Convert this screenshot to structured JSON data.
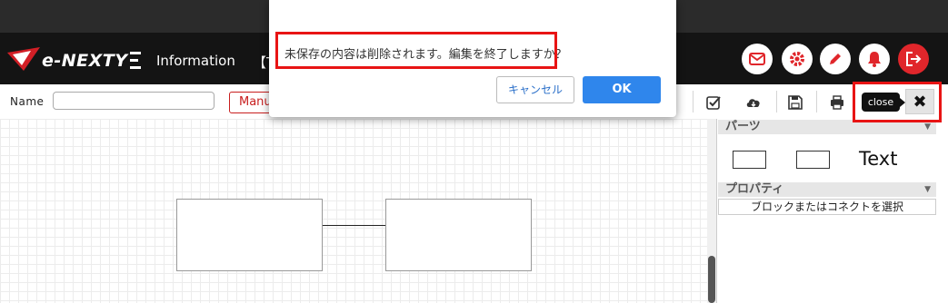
{
  "header": {
    "logo_text": "e-NEXTY",
    "nav": [
      "Information",
      "【T"
    ],
    "icons": [
      "mail-icon",
      "gear-icon",
      "pencil-icon",
      "bell-icon",
      "logout-icon"
    ],
    "accent_color": "#e0262b"
  },
  "toolbar": {
    "name_label": "Name",
    "name_value": "",
    "manual_label": "Manu",
    "icons": [
      "check-icon",
      "cloud-download-icon",
      "save-icon",
      "print-icon"
    ],
    "tooltip": "close",
    "close_label": "✖"
  },
  "panel": {
    "parts_title": "パーツ",
    "parts_text_label": "Text",
    "properties_title": "プロパティ",
    "properties_message": "ブロックまたはコネクトを選択"
  },
  "dialog": {
    "message": "未保存の内容は削除されます。編集を終了しますか？",
    "cancel_label": "キャンセル",
    "ok_label": "OK"
  }
}
